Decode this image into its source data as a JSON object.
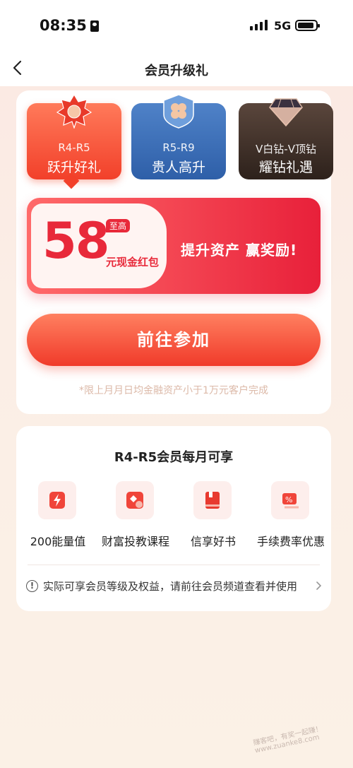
{
  "status_bar": {
    "time": "08:35",
    "network": "5G"
  },
  "nav": {
    "title": "会员升级礼"
  },
  "tabs": [
    {
      "range": "R4-R5",
      "label": "跃升好礼",
      "selected": true
    },
    {
      "range": "R5-R9",
      "label": "贵人高升",
      "selected": false
    },
    {
      "range": "V白钻-V顶钻",
      "label": "耀钻礼遇",
      "selected": false
    }
  ],
  "offer": {
    "amount": "58",
    "badge": "至高",
    "unit": "元现金红包",
    "slogan": "提升资产  赢奖励!"
  },
  "cta": {
    "label": "前往参加"
  },
  "note": "*限上月月日均金融资产小于1万元客户完成",
  "benefits_section": {
    "title": "R4-R5会员每月可享",
    "items": [
      {
        "label": "200能量值",
        "icon": "energy-icon"
      },
      {
        "label": "财富投教课程",
        "icon": "course-icon"
      },
      {
        "label": "信享好书",
        "icon": "book-icon"
      },
      {
        "label": "手续费率优惠",
        "icon": "discount-icon"
      }
    ],
    "info": "实际可享会员等级及权益，请前往会员频道查看并使用"
  },
  "watermark": "赚客吧，有奖一起赚！www.zuanke8.com",
  "colors": {
    "accent": "#f03a2a",
    "primary_red": "#e8293a",
    "blue": "#2e5fa8",
    "dark": "#2d211b"
  }
}
